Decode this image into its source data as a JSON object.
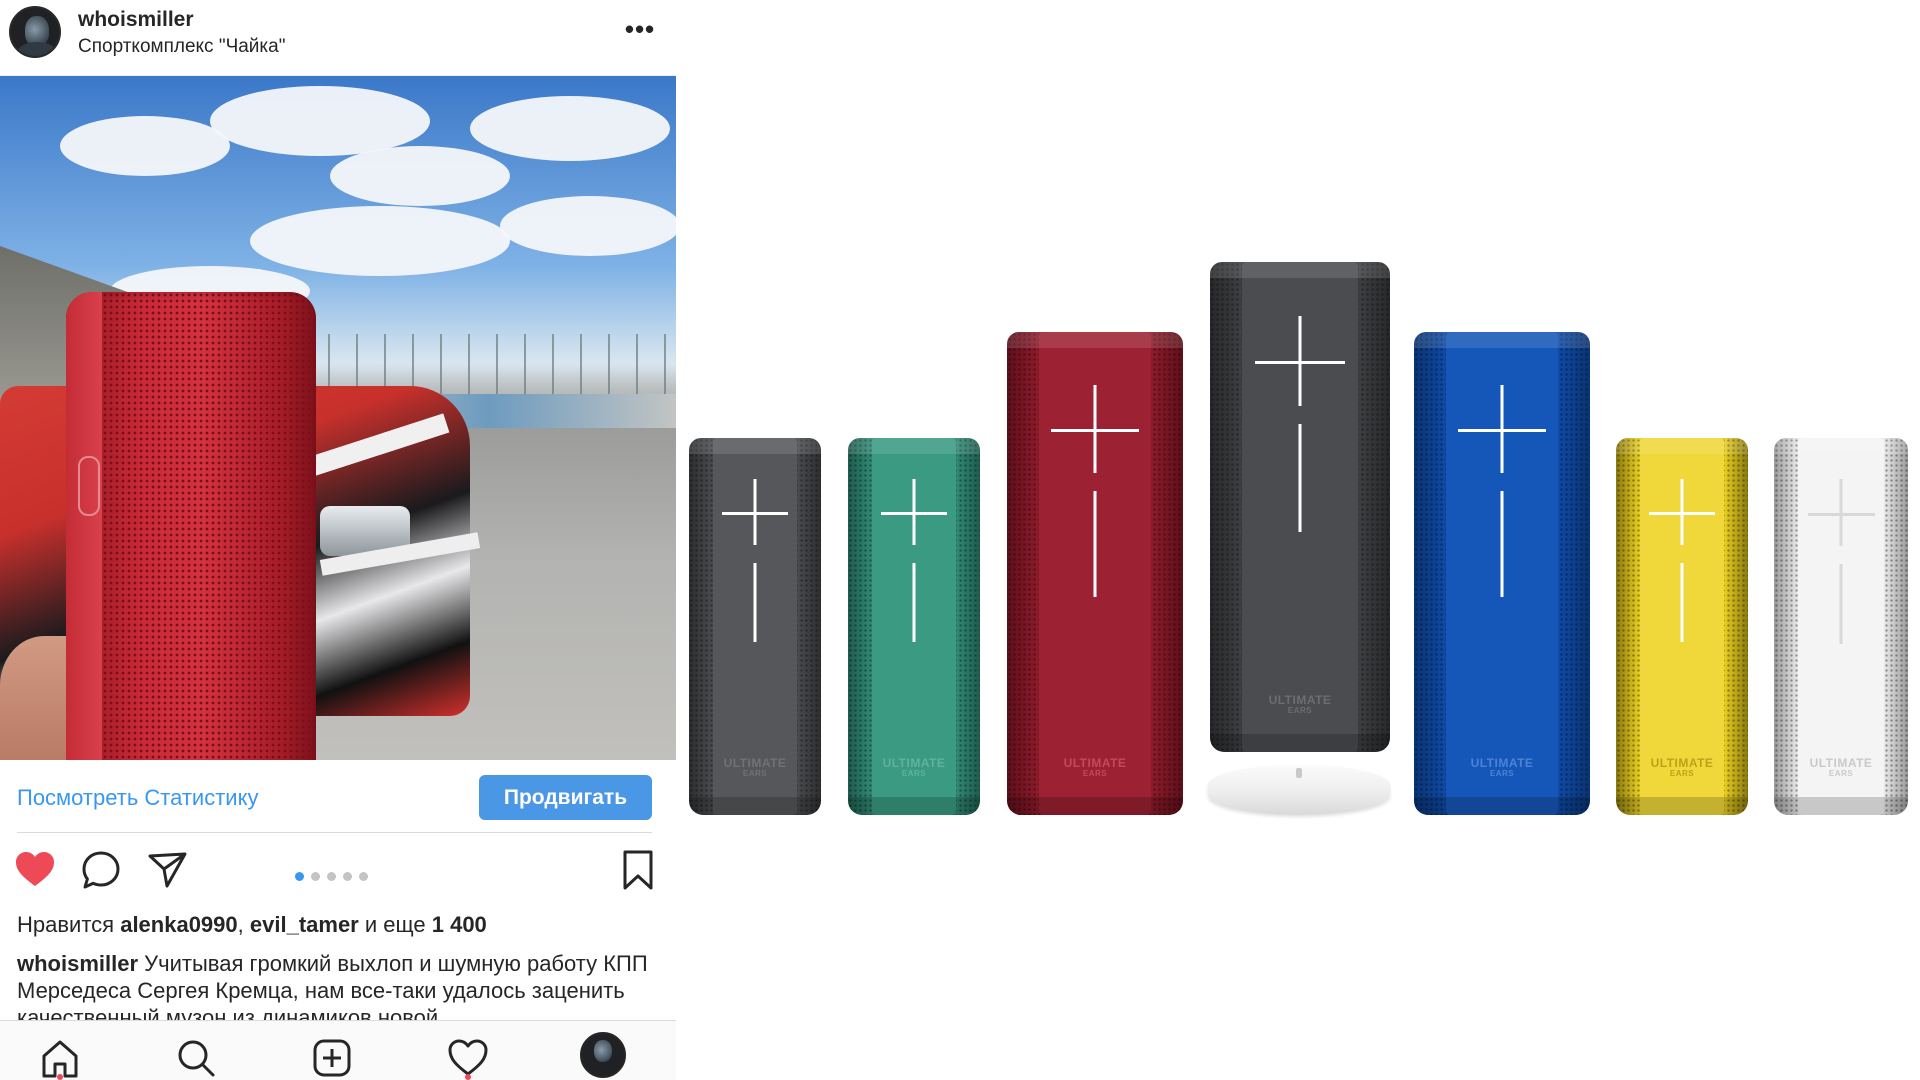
{
  "post": {
    "username": "whoismiller",
    "location": "Спорткомплекс \"Чайка\"",
    "more_label": "•••"
  },
  "stats": {
    "view_stats_label": "Посмотреть Статистику",
    "promote_label": "Продвигать"
  },
  "carousel": {
    "total": 5,
    "active_index": 0
  },
  "likes": {
    "prefix": "Нравится",
    "user1": "alenka0990",
    "separator": ",",
    "user2": "evil_tamer",
    "middle": "и еще",
    "count": "1 400"
  },
  "caption": {
    "author": "whoismiller",
    "text": "Учитывая громкий выхлоп и шумную работу КПП Мерседеса Сергея Кремца, нам все-таки удалось заценить качественный музон из динамиков новой"
  },
  "bottom_nav": {
    "items": [
      "home-icon",
      "search-icon",
      "add-icon",
      "heart-icon",
      "profile-avatar"
    ]
  },
  "colors": {
    "link": "#3897f0",
    "promote_button": "#4a97e6",
    "like_heart": "#ed4956"
  },
  "lineup": {
    "brand_line1": "ULTIMATE",
    "brand_line2": "EARS",
    "speakers": [
      {
        "name": "speaker-graphite",
        "color": "#4a4b4e",
        "band": "#55575a",
        "dark": "#2d2e30",
        "brand_color": "#6f7174"
      },
      {
        "name": "speaker-teal",
        "color": "#2f8a74",
        "band": "#3a9a82",
        "dark": "#1f5c4d",
        "brand_color": "#5fb39c"
      },
      {
        "name": "speaker-red",
        "color": "#8e1b2b",
        "band": "#9c2233",
        "dark": "#5e0f1a",
        "brand_color": "#c24b5a"
      },
      {
        "name": "speaker-graphite-large",
        "color": "#3f4043",
        "band": "#4b4c50",
        "dark": "#27282a",
        "brand_color": "#6b6d70"
      },
      {
        "name": "speaker-blue",
        "color": "#0e4aa6",
        "band": "#1557b8",
        "dark": "#0a3372",
        "brand_color": "#4d82d6"
      },
      {
        "name": "speaker-yellow",
        "color": "#e9cf22",
        "band": "#f0d83a",
        "dark": "#8a7a10",
        "brand_color": "#b9a318"
      },
      {
        "name": "speaker-white",
        "color": "#e9e9e9",
        "band": "#f4f4f4",
        "dark": "#9a9a9a",
        "brand_color": "#c9c9c9"
      }
    ]
  }
}
